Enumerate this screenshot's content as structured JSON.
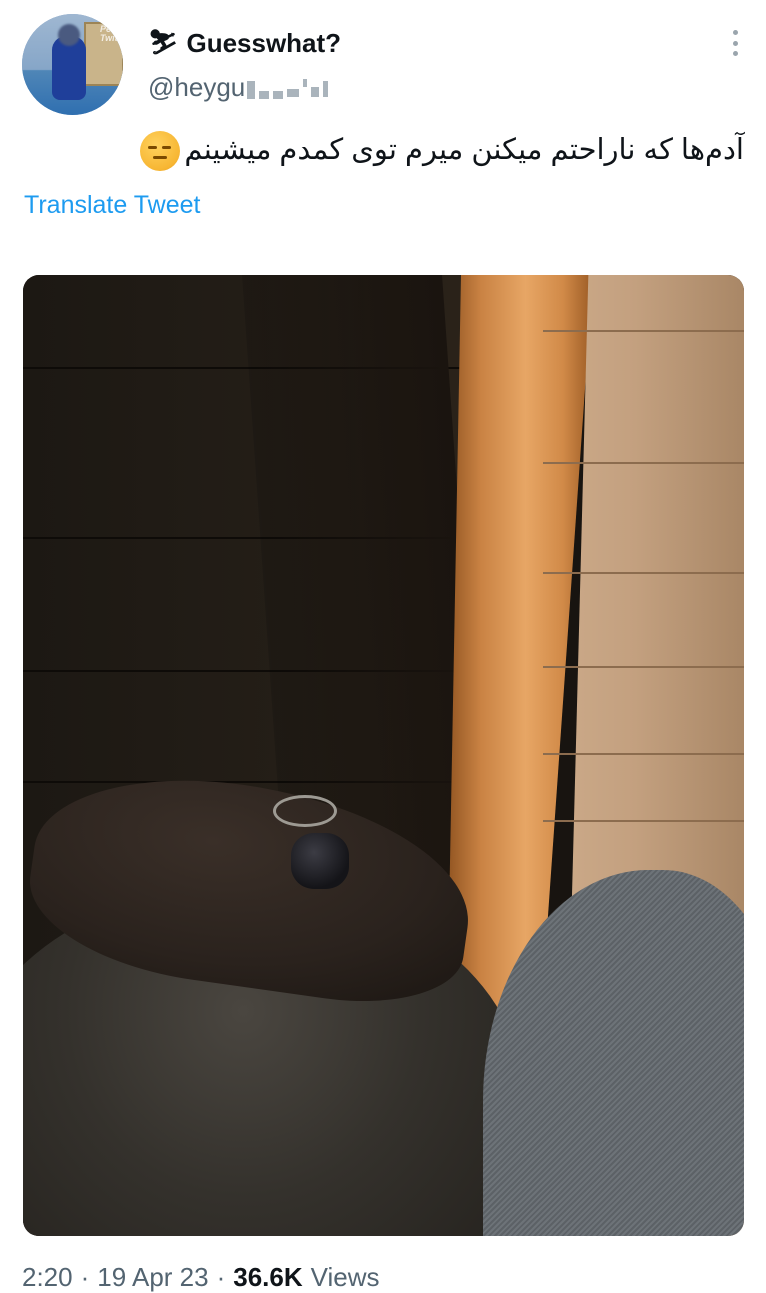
{
  "tweet": {
    "author": {
      "emoji": "⛷",
      "display_name": "Guesswhat?",
      "handle": "@heygu",
      "avatar_watermark": "Official\nPersian\nTwitter"
    },
    "text": "آدم‌ها که ناراحتم میکنن میرم توی کمدم میشینم",
    "emoji": "pensive-face",
    "translate_label": "Translate Tweet",
    "media": {
      "description_icon": "photo"
    },
    "meta": {
      "time": "2:20",
      "separator": "·",
      "date": "19 Apr 23",
      "views_count": "36.6K",
      "views_label": "Views"
    }
  },
  "colors": {
    "accent": "#1d9bf0",
    "secondary_text": "#536471",
    "primary_text": "#0f1419"
  }
}
